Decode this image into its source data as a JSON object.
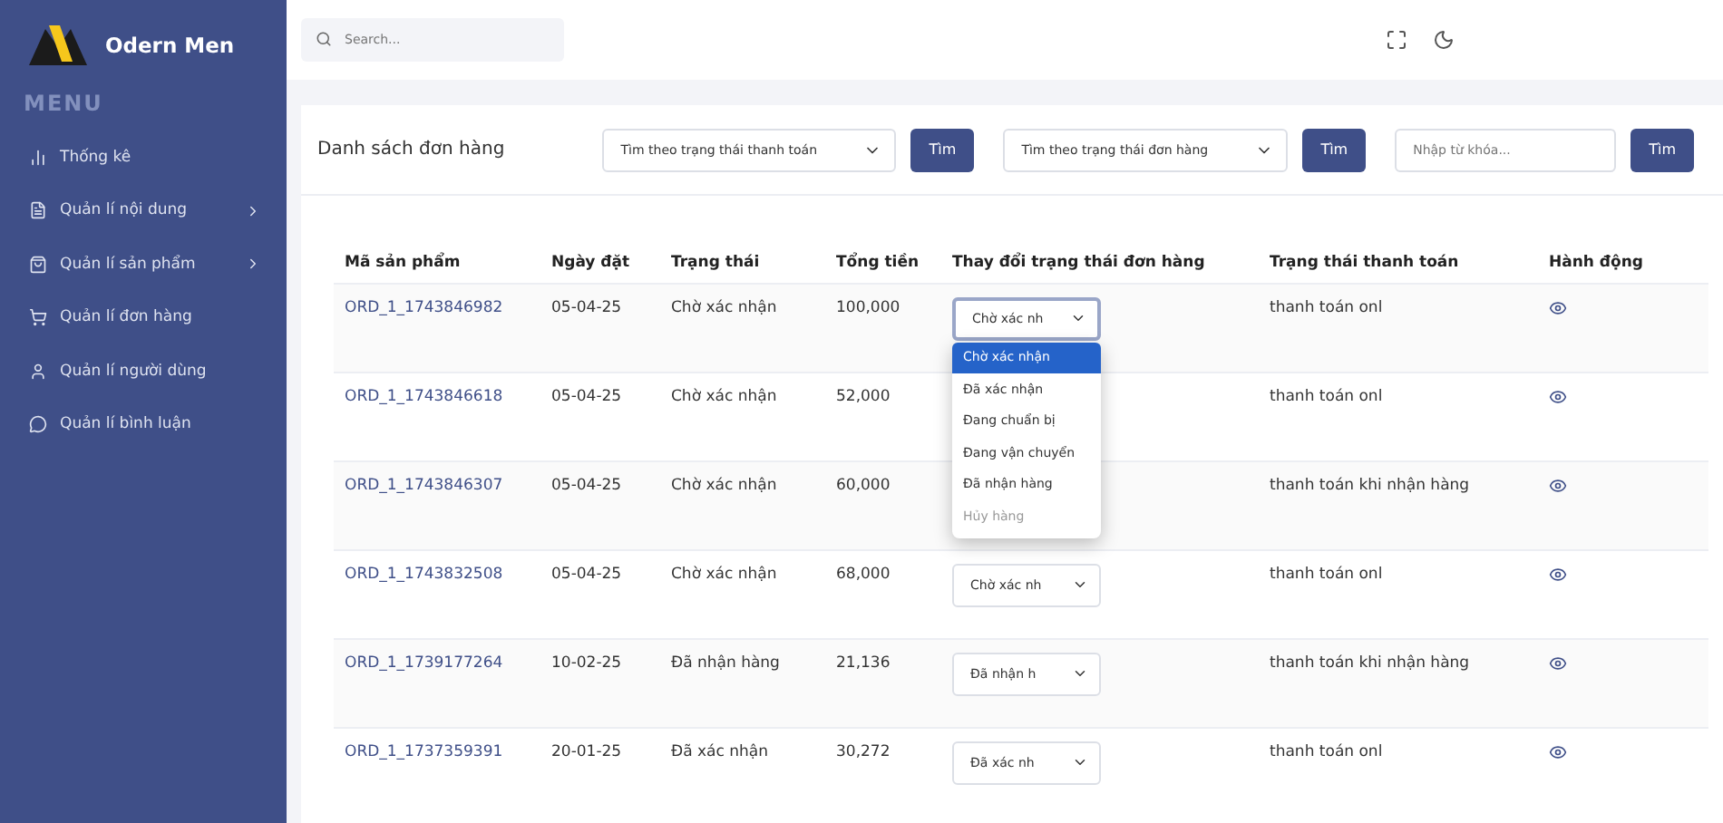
{
  "brand": {
    "name": "Odern Men"
  },
  "menu_title": "MENU",
  "sidebar": {
    "items": [
      {
        "label": "Thống kê",
        "has_submenu": false
      },
      {
        "label": "Quản lí nội dung",
        "has_submenu": true
      },
      {
        "label": "Quản lí sản phẩm",
        "has_submenu": true
      },
      {
        "label": "Quản lí đơn hàng",
        "has_submenu": false
      },
      {
        "label": "Quản lí người dùng",
        "has_submenu": false
      },
      {
        "label": "Quản lí bình luận",
        "has_submenu": false
      }
    ]
  },
  "search": {
    "placeholder": "Search..."
  },
  "card": {
    "title": "Danh sách đơn hàng",
    "filters": [
      {
        "kind": "select",
        "value": "Tìm theo trạng thái thanh toán",
        "button": "Tìm"
      },
      {
        "kind": "select",
        "value": "Tìm theo trạng thái đơn hàng",
        "button": "Tìm"
      },
      {
        "kind": "input",
        "placeholder": "Nhập từ khóa...",
        "button": "Tìm"
      }
    ]
  },
  "table": {
    "columns": [
      "Mã sản phẩm",
      "Ngày đặt",
      "Trạng thái",
      "Tổng tiền",
      "Thay đổi trạng thái đơn hàng",
      "Trạng thái thanh toán",
      "Hành động"
    ],
    "rows": [
      {
        "code": "ORD_1_1743846982",
        "date": "05-04-25",
        "status": "Chờ xác nhận",
        "total": "100,000",
        "select": "Chờ xác nh",
        "open": true,
        "payment": "thanh toán onl"
      },
      {
        "code": "ORD_1_1743846618",
        "date": "05-04-25",
        "status": "Chờ xác nhận",
        "total": "52,000",
        "payment": "thanh toán onl"
      },
      {
        "code": "ORD_1_1743846307",
        "date": "05-04-25",
        "status": "Chờ xác nhận",
        "total": "60,000",
        "payment": "thanh toán khi nhận hàng"
      },
      {
        "code": "ORD_1_1743832508",
        "date": "05-04-25",
        "status": "Chờ xác nhận",
        "total": "68,000",
        "select": "Chờ xác nh",
        "open": false,
        "payment": "thanh toán onl"
      },
      {
        "code": "ORD_1_1739177264",
        "date": "10-02-25",
        "status": "Đã nhận hàng",
        "total": "21,136",
        "select": "Đã nhận h",
        "open": false,
        "payment": "thanh toán khi nhận hàng"
      },
      {
        "code": "ORD_1_1737359391",
        "date": "20-01-25",
        "status": "Đã xác nhận",
        "total": "30,272",
        "select": "Đã xác nh",
        "open": false,
        "payment": "thanh toán onl"
      }
    ]
  },
  "status_options": [
    {
      "label": "Chờ xác nhận",
      "selected": true,
      "disabled": false
    },
    {
      "label": "Đã xác nhận",
      "selected": false,
      "disabled": false
    },
    {
      "label": "Đang chuẩn bị",
      "selected": false,
      "disabled": false
    },
    {
      "label": "Đang vận chuyển",
      "selected": false,
      "disabled": false
    },
    {
      "label": "Đã nhận hàng",
      "selected": false,
      "disabled": false
    },
    {
      "label": "Hủy hàng",
      "selected": false,
      "disabled": true
    }
  ]
}
